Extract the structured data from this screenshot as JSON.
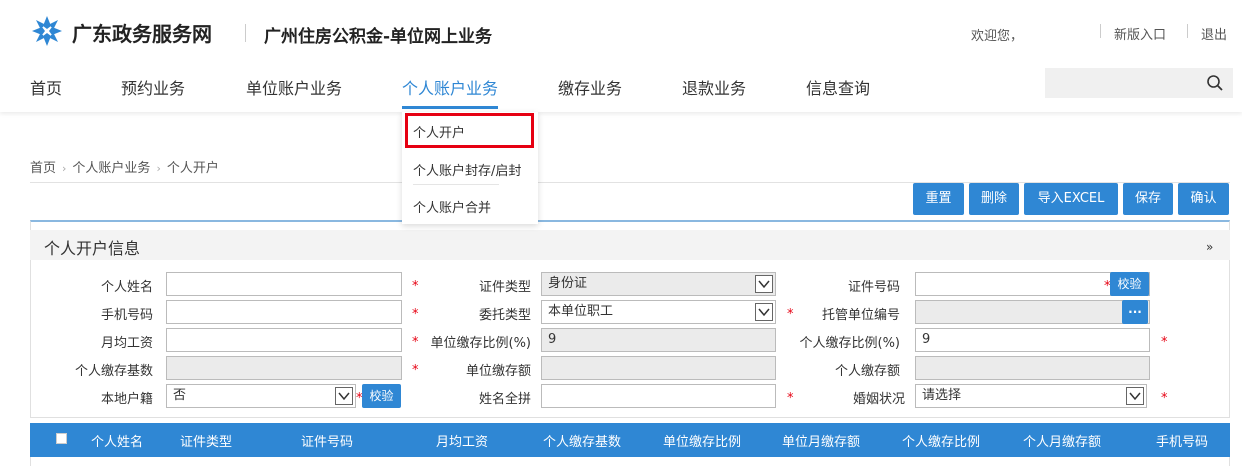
{
  "header": {
    "site_name": "广东政务服务网",
    "sub_title": "广州住房公积金-单位网上业务",
    "welcome": "欢迎您，",
    "new_entry": "新版入口",
    "logout": "退出"
  },
  "nav": {
    "items": [
      "首页",
      "预约业务",
      "单位账户业务",
      "个人账户业务",
      "缴存业务",
      "退款业务",
      "信息查询"
    ],
    "active": "个人账户业务"
  },
  "dropdown": {
    "items": [
      "个人开户",
      "个人账户封存/启封",
      "个人账户合并"
    ]
  },
  "breadcrumb": [
    "首页",
    "个人账户业务",
    "个人开户"
  ],
  "toolbar": {
    "reset": "重置",
    "delete": "删除",
    "import_excel": "导入EXCEL",
    "save": "保存",
    "confirm": "确认"
  },
  "panel": {
    "title": "个人开户信息"
  },
  "form": {
    "name_label": "个人姓名",
    "name_value": "",
    "id_type_label": "证件类型",
    "id_type_value": "身份证",
    "id_no_label": "证件号码",
    "id_no_value": "",
    "verify_label": "校验",
    "phone_label": "手机号码",
    "phone_value": "",
    "entrust_label": "委托类型",
    "entrust_value": "本单位职工",
    "custody_label": "托管单位编号",
    "custody_value": "",
    "more_label": "...",
    "salary_label": "月均工资",
    "salary_value": "",
    "unit_ratio_label": "单位缴存比例(%)",
    "unit_ratio_value": "9",
    "person_ratio_label": "个人缴存比例(%)",
    "person_ratio_value": "9",
    "base_label": "个人缴存基数",
    "base_value": "",
    "unit_amount_label": "单位缴存额",
    "unit_amount_value": "",
    "person_amount_label": "个人缴存额",
    "person_amount_value": "",
    "local_label": "本地户籍",
    "local_value": "否",
    "pinyin_label": "姓名全拼",
    "pinyin_value": "",
    "marriage_label": "婚姻状况",
    "marriage_value": "请选择",
    "required_mark": "*"
  },
  "table": {
    "columns": [
      "个人姓名",
      "证件类型",
      "证件号码",
      "月均工资",
      "个人缴存基数",
      "单位缴存比例",
      "单位月缴存额",
      "个人缴存比例",
      "个人月缴存额",
      "手机号码"
    ]
  },
  "colors": {
    "accent": "#2f87d4",
    "highlight": "#e60012"
  }
}
